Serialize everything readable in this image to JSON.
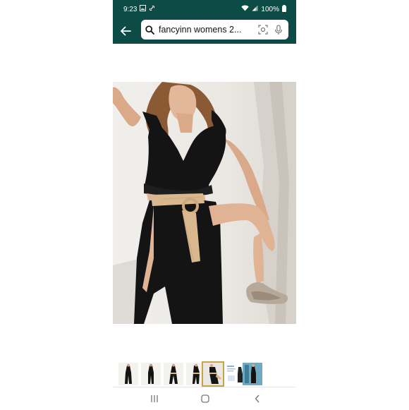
{
  "status_bar": {
    "time": "9:23",
    "battery": "100%"
  },
  "search": {
    "query": "fancyinn womens 2..."
  },
  "icons": {
    "back": "back-arrow-icon",
    "search": "search-icon",
    "camera": "camera-scan-icon",
    "mic": "microphone-icon"
  },
  "gallery": {
    "thumbnail_count": 7,
    "selected_index": 4
  },
  "navigation": {
    "recents": "recent-apps-icon",
    "home": "home-icon",
    "back": "nav-back-icon"
  },
  "colors": {
    "header": "#0c4b46",
    "outfit": "#141414",
    "belt": "#d9b88f"
  }
}
